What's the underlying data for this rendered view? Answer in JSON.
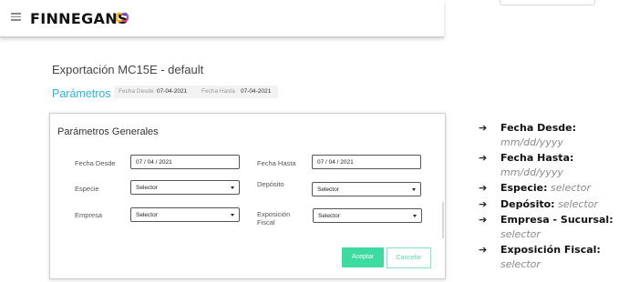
{
  "header": {
    "brand": "FINNEGANS"
  },
  "page": {
    "title": "Exportación MC15E - default",
    "params_link": "Parámetros >",
    "summary": [
      {
        "key": "Fecha Desde",
        "value": "07-04-2021"
      },
      {
        "key": "Fecha Hasta",
        "value": "07-04-2021"
      }
    ]
  },
  "panel": {
    "title": "Parámetros Generales",
    "fecha_desde": {
      "label": "Fecha Desde",
      "value": "07 / 04 / 2021"
    },
    "fecha_hasta": {
      "label": "Fecha Hasta",
      "value": "07 / 04 / 2021"
    },
    "especie": {
      "label": "Especie",
      "value": "Selector"
    },
    "deposito": {
      "label": "Depósito",
      "value": "Selector"
    },
    "empresa": {
      "label": "Empresa",
      "value": "Selector"
    },
    "exposicion": {
      "label_line1": "Exposición",
      "label_line2": "Fiscal",
      "value": "Selector"
    },
    "accept": "Aceptar",
    "cancel": "Cancelar"
  },
  "notes": [
    {
      "term": "Fecha Desde:",
      "desc": "mm/dd/yyyy"
    },
    {
      "term": "Fecha Hasta:",
      "desc": "mm/dd/yyyy"
    },
    {
      "term": "Especie:",
      "desc": "selector"
    },
    {
      "term": "Depósito:",
      "desc": "selector"
    },
    {
      "term": "Empresa - Sucursal:",
      "desc": "selector"
    },
    {
      "term": "Exposición Fiscal:",
      "desc": "selector"
    }
  ],
  "colors": {
    "accent": "#2bb4d8",
    "accept": "#3ddba2",
    "cancel": "#5cd4b0"
  }
}
